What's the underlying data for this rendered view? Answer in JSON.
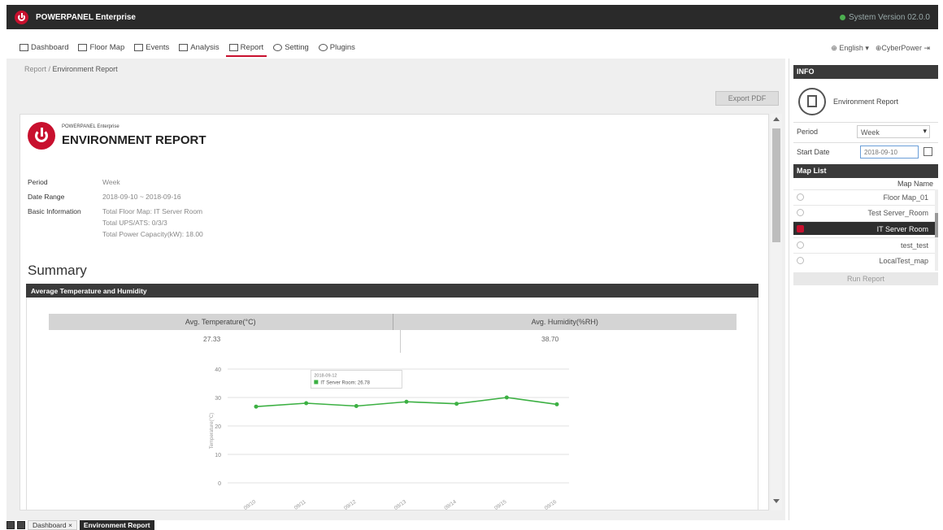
{
  "app": {
    "title": "POWERPANEL Enterprise",
    "system_version": "System Version 02.0.0"
  },
  "nav": {
    "items": [
      {
        "label": "Dashboard",
        "icon": "dashboard-icon"
      },
      {
        "label": "Floor Map",
        "icon": "floor-map-icon"
      },
      {
        "label": "Events",
        "icon": "events-icon"
      },
      {
        "label": "Analysis",
        "icon": "analysis-icon"
      },
      {
        "label": "Report",
        "icon": "report-icon",
        "active": true
      },
      {
        "label": "Setting",
        "icon": "gear-icon"
      },
      {
        "label": "Plugins",
        "icon": "plugins-icon"
      }
    ]
  },
  "breadcrumb": {
    "parent": "Report",
    "current": "Environment Report"
  },
  "export_label": "Export PDF",
  "report": {
    "brand": "POWERPANEL Enterprise",
    "title": "ENVIRONMENT REPORT",
    "period_label": "Period",
    "period_value": "Week",
    "range_label": "Date Range",
    "range_value": "2018-09-10 ~ 2018-09-16",
    "basic_label": "Basic Information",
    "basic_lines": [
      "Total Floor Map: IT Server Room",
      "Total UPS/ATS: 0/3/3",
      "Total Power Capacity(kW): 18.00"
    ],
    "summary": "Summary",
    "section_title": "Average Temperature and Humidity",
    "avg_temp_label": "Avg. Temperature(°C)",
    "avg_temp_value": "27.33",
    "avg_hum_label": "Avg. Humidity(%RH)",
    "avg_hum_value": "38.70"
  },
  "chart_data": {
    "type": "line",
    "ylabel": "Temperature(°C)",
    "ylim": [
      0,
      40
    ],
    "yticks": [
      "40",
      "30",
      "20",
      "10",
      "0"
    ],
    "categories": [
      "09/10",
      "09/11",
      "09/12",
      "09/13",
      "09/14",
      "09/15",
      "09/16"
    ],
    "series": [
      {
        "name": "IT Server Room (°C)",
        "values": [
          26.8,
          28.0,
          27.0,
          28.5,
          27.8,
          30.0,
          27.6
        ]
      }
    ],
    "tooltip": {
      "date": "2018-09-12",
      "text": "IT Server Room: 26.78"
    },
    "color": "#3cb043",
    "grid": true
  },
  "right": {
    "top_links": {
      "language": "English",
      "user": "CyberPower"
    },
    "info_header": "INFO",
    "report_name": "Environment Report",
    "period_label": "Period",
    "period_value": "Week",
    "start_label": "Start Date",
    "start_value": "2018-09-10",
    "maplist_header": "Map List",
    "map_col": "Map Name",
    "maps": [
      {
        "name": "Floor Map_01",
        "selected": false
      },
      {
        "name": "Test Server_Room",
        "selected": false
      },
      {
        "name": "IT Server Room",
        "selected": true
      },
      {
        "name": "test_test",
        "selected": false
      },
      {
        "name": "LocalTest_map",
        "selected": false
      }
    ],
    "run_label": "Run Report"
  },
  "bottom": {
    "tab1": "Dashboard",
    "tab2": "Environment Report"
  }
}
